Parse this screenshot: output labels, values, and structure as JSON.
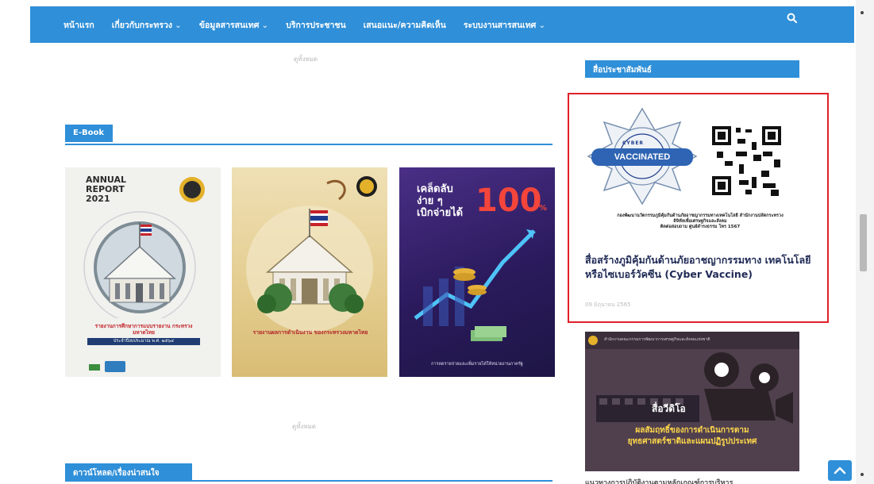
{
  "nav": {
    "items": [
      {
        "label": "หน้าแรก",
        "has_caret": false
      },
      {
        "label": "เกี่ยวกับกระทรวง",
        "has_caret": true
      },
      {
        "label": "ข้อมูลสารสนเทศ",
        "has_caret": true
      },
      {
        "label": "บริการประชาชน",
        "has_caret": false
      },
      {
        "label": "เสนอแนะ/ความคิดเห็น",
        "has_caret": false
      },
      {
        "label": "ระบบงานสารสนเทศ",
        "has_caret": true
      }
    ],
    "caret": "⌄",
    "search_icon": "search-icon",
    "color": "#2f8fd8"
  },
  "captions": {
    "top_faint": "ดูทั้งหมด",
    "mid_faint": "ดูทั้งหมด"
  },
  "sections": {
    "ebook": "E-Book",
    "downloads": "ดาวน์โหลด/เรื่องน่าสนใจ",
    "pr_media": "สื่อประชาสัมพันธ์"
  },
  "books": {
    "b1": {
      "title_lines": [
        "ANNUAL",
        "REPORT",
        "2021"
      ],
      "subtitle": "รายงานการศึกษาการแบบรายงาน กระทรวงมหาดไทย",
      "sub2": "ประจำปีงบประมาณ พ.ศ. ๒๕๖๔"
    },
    "b2": {
      "subtitle": "รายงานผลการดำเนินงาน ของกระทรวงมหาดไทย"
    },
    "b3": {
      "headline_1": "เคล็ดลับ",
      "headline_2": "ง่าย ๆ",
      "headline_3": "เบิกจ่ายได้",
      "big_number": "100",
      "suffix": "%",
      "footer": "การลดรายจ่ายและเพิ่มรายได้ให้หน่วยงานภาครัฐ"
    }
  },
  "featured": {
    "badge_text": "VACCINATED",
    "badge_arc_top": "CYBER",
    "caption_small": "กองพัฒนานวัตกรรมภูมิคุ้มกันด้านภัยอาชญากรรมทางเทคโนโลยี สำนักงานปลัดกระทรวง",
    "caption_small_2": "ดิจิทัลเพื่อเศรษฐกิจและสังคม",
    "caption_small_3": "ติดต่อสอบถาม ศูนย์ดำรงธรรม โทร 1567",
    "title": "สื่อสร้างภูมิคุ้มกันด้านภัยอาชญากรรมทาง เทคโนโลยี หรือไซเบอร์วัคซีน (Cyber Vaccine)",
    "date": "09 มิถุนายน 2565"
  },
  "video": {
    "banner_top": "สำนักงานคณะกรรมการพัฒนาการเศรษฐกิจและสังคมแห่งชาติ",
    "label": "สื่อวีดิโอ",
    "line1": "ผลสัมฤทธิ์ของการดำเนินการตาม",
    "line2": "ยุทธศาสตร์ชาติและแผนปฏิรูปประเทศ"
  },
  "bottom_cut_text": "แนวทางการปฏิบัติงานตามหลักเกณฑ์การบริหาร",
  "colors": {
    "accent": "#2f8fd8",
    "highlight_border": "#e0202a",
    "title_text": "#1f2a55"
  }
}
